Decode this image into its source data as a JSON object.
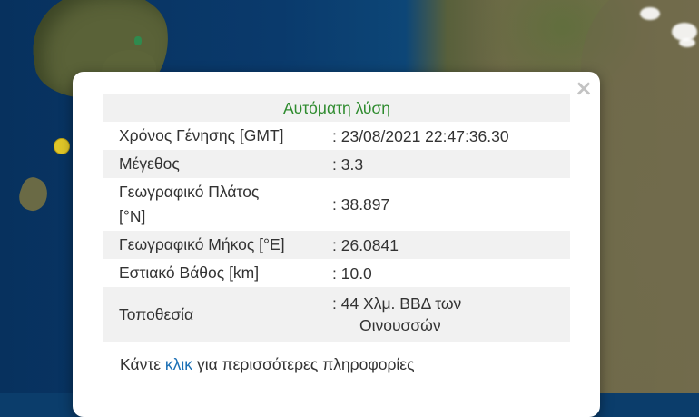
{
  "popup": {
    "title": "Αυτόματη λύση",
    "close_symbol": "×",
    "rows": [
      {
        "label": "Χρόνος Γένησης [GMT]",
        "value": ": 23/08/2021 22:47:36.30"
      },
      {
        "label": "Μέγεθος",
        "value": ": 3.3"
      },
      {
        "label_line1": "Γεωγραφικό Πλάτος",
        "label_line2": "[°N]",
        "value": ": 38.897"
      },
      {
        "label": "Γεωγραφικό Μήκος [°E]",
        "value": ": 26.0841"
      },
      {
        "label": "Εστιακό Βάθος [km]",
        "value": ": 10.0"
      },
      {
        "label": "Τοποθεσία",
        "value_line1": ": 44 Χλμ. ΒΒΔ των",
        "value_line2": "Οινουσσών"
      }
    ],
    "footer": {
      "prefix": "Κάντε",
      "link": "κλικ",
      "suffix": "για περισσότερες πληροφορίες"
    }
  },
  "colors": {
    "title": "#2e8b2e",
    "link": "#1a6fb5",
    "row_shade": "#f1f1f1",
    "marker": "#e0c628"
  }
}
